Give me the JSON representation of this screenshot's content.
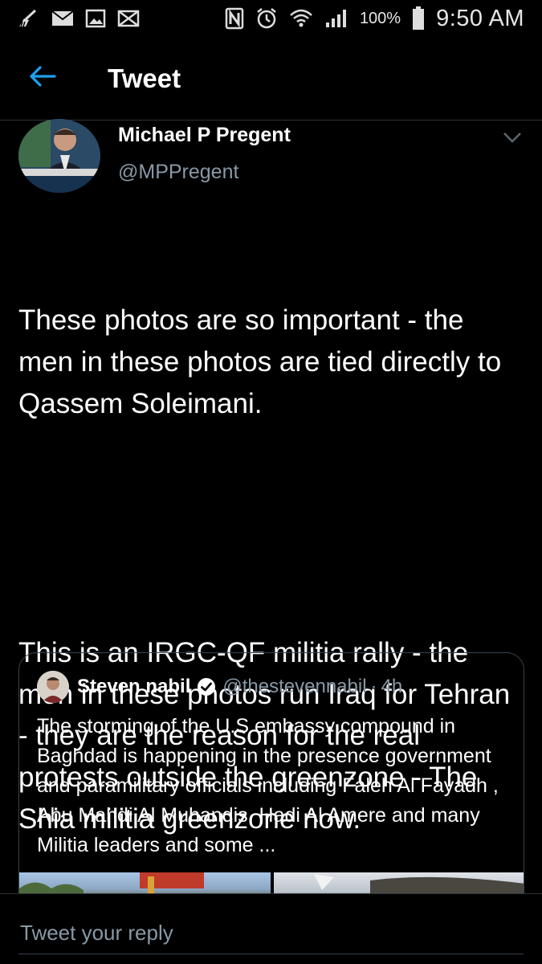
{
  "status_bar": {
    "left_icons": [
      "broom-icon",
      "mail-icon",
      "image-icon",
      "envelope-crossed-icon"
    ],
    "right_icons": [
      "nfc-icon",
      "alarm-icon",
      "wifi-icon",
      "signal-icon"
    ],
    "battery_percent": "100%",
    "time": "9:50 AM"
  },
  "appbar": {
    "title": "Tweet"
  },
  "tweet": {
    "author_name": "Michael P Pregent",
    "author_handle": "@MPPregent",
    "paragraphs": [
      "These photos are so important - the men in these photos are tied directly to Qassem Soleimani.",
      "This is an IRGC-QF militia rally - the men in these photos run Iraq for Tehran - they are the reason for the real protests outside the greenzone - The Shia militia greenzone now."
    ]
  },
  "quote": {
    "author_name": "Steven nabil",
    "author_handle": "@thestevennabil",
    "separator": "·",
    "time": "4h",
    "text": "The  storming of the U.S embassy compound in Baghdad is happening in the presence government and paramilitary officials including Faleh Al Fayadh , Abu Mahdi Al Muhandis, Hadi Al Amere and many Militia leaders and some ..."
  },
  "reply": {
    "placeholder": "Tweet your reply"
  },
  "colors": {
    "background": "#000000",
    "accent": "#1da1f2",
    "secondary_text": "#8899a6",
    "border": "#38444d"
  }
}
